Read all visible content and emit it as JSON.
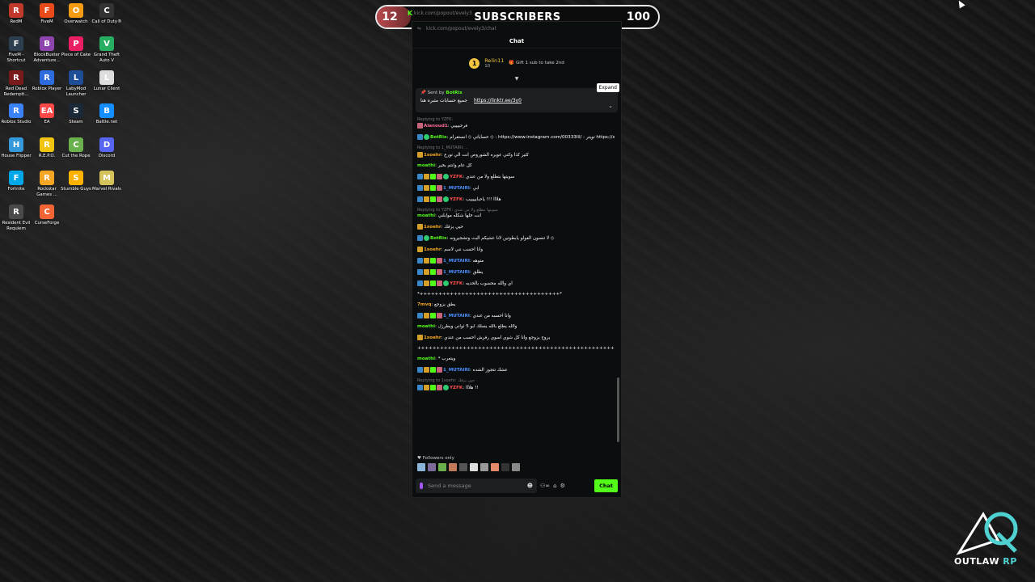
{
  "desktop": {
    "icons": [
      {
        "label": "RedM",
        "color": "#c0392b",
        "glyph": "R"
      },
      {
        "label": "FiveM",
        "color": "#e84a1a",
        "glyph": "F"
      },
      {
        "label": "Overwatch",
        "color": "#f39c12",
        "glyph": "O"
      },
      {
        "label": "Call of Duty®",
        "color": "#333333",
        "glyph": "C"
      },
      {
        "label": "FiveM - Shortcut",
        "color": "#2c3e50",
        "glyph": "F"
      },
      {
        "label": "BlockBuster Adventure...",
        "color": "#8e44ad",
        "glyph": "B"
      },
      {
        "label": "Piece of Cake",
        "color": "#e91e63",
        "glyph": "P"
      },
      {
        "label": "Grand Theft Auto V",
        "color": "#27ae60",
        "glyph": "V"
      },
      {
        "label": "Red Dead Redempti...",
        "color": "#7b1a1a",
        "glyph": "R"
      },
      {
        "label": "Roblox Player",
        "color": "#2d6cdf",
        "glyph": "R"
      },
      {
        "label": "LabyMod Launcher",
        "color": "#1f4e99",
        "glyph": "L"
      },
      {
        "label": "Lunar Client",
        "color": "#dddddd",
        "glyph": "L"
      },
      {
        "label": "Roblox Studio",
        "color": "#3b82f6",
        "glyph": "R"
      },
      {
        "label": "EA",
        "color": "#ff4747",
        "glyph": "EA"
      },
      {
        "label": "Steam",
        "color": "#1b2838",
        "glyph": "S"
      },
      {
        "label": "Battle.net",
        "color": "#148eff",
        "glyph": "B"
      },
      {
        "label": "House Flipper",
        "color": "#3498db",
        "glyph": "H"
      },
      {
        "label": "R.E.P.O.",
        "color": "#f1c40f",
        "glyph": "R"
      },
      {
        "label": "Cut the Rope",
        "color": "#6ab04c",
        "glyph": "C"
      },
      {
        "label": "Discord",
        "color": "#5865f2",
        "glyph": "D"
      },
      {
        "label": "Fortnite",
        "color": "#00a8e8",
        "glyph": "F"
      },
      {
        "label": "Rockstar Games ...",
        "color": "#f5a623",
        "glyph": "R"
      },
      {
        "label": "Stumble Guys",
        "color": "#ffb300",
        "glyph": "S"
      },
      {
        "label": "Marvel Rivals",
        "color": "#d4c25b",
        "glyph": "M"
      },
      {
        "label": "Resident Evil Requiem",
        "color": "#4a4a4a",
        "glyph": "R"
      },
      {
        "label": "CurseForge",
        "color": "#f16436",
        "glyph": "C"
      }
    ]
  },
  "subscribers": {
    "current": "12",
    "goal": "100",
    "title": "SUBSCRIBERS",
    "progress_fraction": 0.12,
    "url": "kick.com/popout/evely3"
  },
  "chat": {
    "address": "kick.com/popout/evely3/chat",
    "header": "Chat",
    "leader": {
      "rank": "1",
      "name": "Relin11",
      "amount": "10",
      "gift_text": "Gift 1 sub to take 2nd"
    },
    "pinned": {
      "sent_by": "Sent by",
      "sender": "BotRix",
      "message": "جميع حسابات مثبره هنا",
      "link": "https://linktr.ee/3y0",
      "expand": "Expand"
    },
    "messages": [
      {
        "reply": "Replying to YZFK:",
        "user": "Alanoud1",
        "color": "#ff6b9a",
        "badges": [
          "pk"
        ],
        "text": "فرحييييي"
      },
      {
        "reply": "",
        "user": "BotRix",
        "color": "#53fc18",
        "badges": [
          "bl",
          "vf"
        ],
        "text": "حساباتي ◇ انستقرام ◇ : https://www.instagram.com/00333lll/ : تويتر https://x.com/evely.32"
      },
      {
        "reply": "Replying to 1_MUTAIRI: ..",
        "user": "1soehr",
        "color": "#f5a623",
        "badges": [
          "gd"
        ],
        "text": "كثير كذا وكني عويره الشوروص انت الي تورع"
      },
      {
        "reply": "",
        "user": "moathi",
        "color": "#53fc18",
        "badges": [],
        "text": "كل عام وانتم بخير"
      },
      {
        "reply": "",
        "user": "YZFK",
        "color": "#ff4d4d",
        "badges": [
          "bl",
          "gd",
          "gr",
          "pk",
          "vf"
        ],
        "text": "سويتها بتطلع ولا من عندي"
      },
      {
        "reply": "",
        "user": "1_MUTAIRI",
        "color": "#4a90ff",
        "badges": [
          "bl",
          "gd",
          "gr",
          "pk"
        ],
        "text": "ابي"
      },
      {
        "reply": "",
        "user": "YZFK",
        "color": "#ff4d4d",
        "badges": [
          "bl",
          "gd",
          "gr",
          "pk",
          "vf"
        ],
        "text": "هلااا !!! ياحبايييييب"
      },
      {
        "reply": "Replying to YZFK: سويتها بتطلع ولا من عندي",
        "user": "moathi",
        "color": "#53fc18",
        "badges": [],
        "text": "انت خلها شكله موابلني"
      },
      {
        "reply": "",
        "user": "1soehr",
        "color": "#f5a623",
        "badges": [
          "gd"
        ],
        "text": "حيي يزقك"
      },
      {
        "reply": "",
        "user": "BotRix",
        "color": "#53fc18",
        "badges": [
          "bl",
          "vf"
        ],
        "text": "لا تنسون الفولو يابطوتين لانا عشيكم البث وتشجيرونه ◇"
      },
      {
        "reply": "",
        "user": "1soehr",
        "color": "#f5a623",
        "badges": [
          "gd"
        ],
        "text": "وانا احسب نني لاسم"
      },
      {
        "reply": "",
        "user": "1_MUTAIRI",
        "color": "#4a90ff",
        "badges": [
          "bl",
          "gd",
          "gr",
          "pk"
        ],
        "text": "متوهه"
      },
      {
        "reply": "",
        "user": "1_MUTAIRI",
        "color": "#4a90ff",
        "badges": [
          "bl",
          "gd",
          "gr",
          "pk"
        ],
        "text": "يطلق"
      },
      {
        "reply": "",
        "user": "YZFK",
        "color": "#ff4d4d",
        "badges": [
          "bl",
          "gd",
          "gr",
          "pk",
          "vf"
        ],
        "text": "اي والله محسوب بالحديه"
      },
      {
        "reply": "",
        "user": "",
        "color": "#ffffff",
        "badges": [],
        "text": "*+++++++++++++++++++++++++++++++++++++*"
      },
      {
        "reply": "",
        "user": "7mvq",
        "color": "#f5a623",
        "badges": [],
        "text": "يطق يزوجع"
      },
      {
        "reply": "",
        "user": "1_MUTAIRI",
        "color": "#4a90ff",
        "badges": [
          "bl",
          "gd",
          "gr",
          "pk"
        ],
        "text": "وانا احسبه من عندي"
      },
      {
        "reply": "",
        "user": "moathi",
        "color": "#53fc18",
        "badges": [],
        "text": "والله يطلع بالله يسلك ابو 5 ثواني ويطرزل"
      },
      {
        "reply": "",
        "user": "1soehr",
        "color": "#f5a623",
        "badges": [
          "gd"
        ],
        "text": "يروح يزوجع وانا كل شوي اسوي رفرش احسب من عندي"
      },
      {
        "reply": "",
        "user": "",
        "color": "#ffffff",
        "badges": [],
        "text": "++++++++++++++++++++++++++++++++++++++++++++++++++++++++++++++++++ *"
      },
      {
        "reply": "",
        "user": "moathi",
        "color": "#53fc18",
        "badges": [],
        "text": "* ويتعرب"
      },
      {
        "reply": "",
        "user": "1_MUTAIRI",
        "color": "#4a90ff",
        "badges": [
          "bl",
          "gd",
          "gr",
          "pk"
        ],
        "text": "عشك تتجوز الشده"
      },
      {
        "reply": "Replying to 1soehr: حيي يزقك",
        "user": "YZFK",
        "color": "#ff4d4d",
        "badges": [
          "bl",
          "gd",
          "gr",
          "pk",
          "vf"
        ],
        "text": "هلااا !!"
      }
    ],
    "followers_only": "Followers only",
    "input_placeholder": "Send a message",
    "send_label": "Chat"
  },
  "logo": {
    "text_a": "OUTLAW",
    "text_b": "RP"
  }
}
